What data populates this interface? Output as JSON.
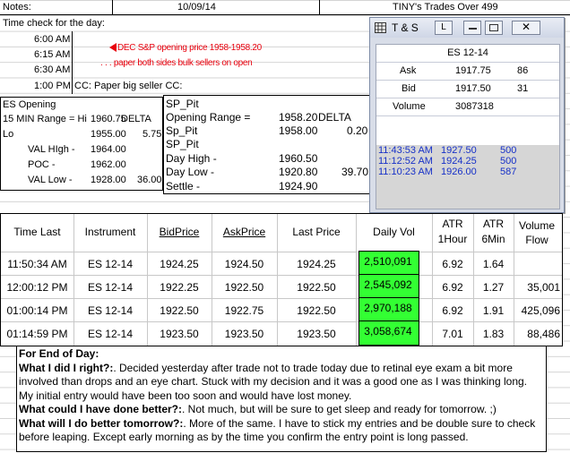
{
  "header": {
    "notes_label": "Notes:",
    "date": "10/09/14",
    "title": "TINY's Trades Over 499"
  },
  "time_check": {
    "label": "Time check for the day:",
    "rows": [
      {
        "time": "6:00 AM",
        "note": ""
      },
      {
        "time": "6:15 AM",
        "note": ""
      },
      {
        "time": "6:30 AM",
        "note": ""
      },
      {
        "time": "1:00 PM",
        "note": "CC: Paper big seller CC:"
      }
    ]
  },
  "red_note": {
    "line1": "DEC S&P opening price 1958-1958.20",
    "line2": ". . . paper both sides bulk sellers on open"
  },
  "es_box": {
    "title": "ES Opening",
    "rows": [
      {
        "label": "15 MIN Range = Hi",
        "value": "1960.75",
        "extra": "DELTA"
      },
      {
        "label": "Lo",
        "value": "1955.00",
        "extra": "5.75"
      },
      {
        "label": "VAL HIgh  -",
        "value": "1964.00",
        "extra": ""
      },
      {
        "label": "POC  -",
        "value": "1962.00",
        "extra": ""
      },
      {
        "label": "VAL Low  -",
        "value": "1928.00",
        "extra": "36.00"
      }
    ]
  },
  "sp_box": {
    "rows": [
      {
        "label": "SP_Pit",
        "value": "",
        "extra": ""
      },
      {
        "label": "Opening Range =",
        "value": "1958.20",
        "extra": "DELTA"
      },
      {
        "label": "Sp_Pit",
        "value": "1958.00",
        "extra": "0.20"
      },
      {
        "label": "SP_Pit",
        "value": "",
        "extra": ""
      },
      {
        "label": "Day High -",
        "value": "1960.50",
        "extra": ""
      },
      {
        "label": "Day Low -",
        "value": "1920.80",
        "extra": "39.70"
      },
      {
        "label": "Settle -",
        "value": "1924.90",
        "extra": ""
      }
    ]
  },
  "ts_window": {
    "title": "T & S",
    "l_button": "L",
    "symbol": "ES 12-14",
    "quotes": [
      {
        "label": "Ask",
        "price": "1917.75",
        "size": "86"
      },
      {
        "label": "Bid",
        "price": "1917.50",
        "size": "31"
      },
      {
        "label": "Volume",
        "price": "3087318",
        "size": ""
      }
    ],
    "trades": [
      {
        "time": "11:43:53 AM",
        "price": "1927.50",
        "size": "500"
      },
      {
        "time": "11:12:52 AM",
        "price": "1924.25",
        "size": "500"
      },
      {
        "time": "11:10:23 AM",
        "price": "1926.00",
        "size": "587"
      }
    ]
  },
  "trades_table": {
    "headers": {
      "time": "Time Last",
      "instrument": "Instrument",
      "bid": "BidPrice",
      "ask": "AskPrice",
      "last": "Last Price",
      "vol": "Daily Vol",
      "atr1a": "ATR",
      "atr1b": "1Hour",
      "atr6a": "ATR",
      "atr6b": "6Min",
      "flowa": "Volume",
      "flowb": "Flow"
    },
    "rows": [
      {
        "time": "11:50:34 AM",
        "instrument": "ES 12-14",
        "bid": "1924.25",
        "ask": "1924.50",
        "last": "1924.25",
        "vol": "2,510,091",
        "atr1": "6.92",
        "atr6": "1.64",
        "flow": ""
      },
      {
        "time": "12:00:12 PM",
        "instrument": "ES 12-14",
        "bid": "1922.25",
        "ask": "1922.50",
        "last": "1922.50",
        "vol": "2,545,092",
        "atr1": "6.92",
        "atr6": "1.27",
        "flow": "35,001"
      },
      {
        "time": "01:00:14 PM",
        "instrument": "ES 12-14",
        "bid": "1922.50",
        "ask": "1922.75",
        "last": "1922.50",
        "vol": "2,970,188",
        "atr1": "6.92",
        "atr6": "1.91",
        "flow": "425,096"
      },
      {
        "time": "01:14:59 PM",
        "instrument": "ES 12-14",
        "bid": "1923.50",
        "ask": "1923.50",
        "last": "1923.50",
        "vol": "3,058,674",
        "atr1": "7.01",
        "atr6": "1.83",
        "flow": "88,486"
      }
    ]
  },
  "end_of_day": {
    "title": "For End of Day:",
    "q1": "What I did I right?:",
    "a1": ".  Decided yesterday after trade not to trade today due to retinal eye exam a bit more involved than drops and an eye chart. Stuck with my decision and it was a good one as I was thinking long.  My initial entry would have been too soon and would have lost money.",
    "q2": "What could I have done better?:",
    "a2": ".  Not much, but will be sure to get sleep and ready for tomorrow. ;)",
    "q3": "What will I do better tomorrow?:",
    "a3": ".  More of the same.  I have to stick my entries and be double sure to check before leaping.  Except early morning as by the time you confirm the entry point is long passed."
  },
  "colors": {
    "accent_red": "#e8000d",
    "volume_green": "#33ff33",
    "tape_blue": "#1630c8"
  }
}
